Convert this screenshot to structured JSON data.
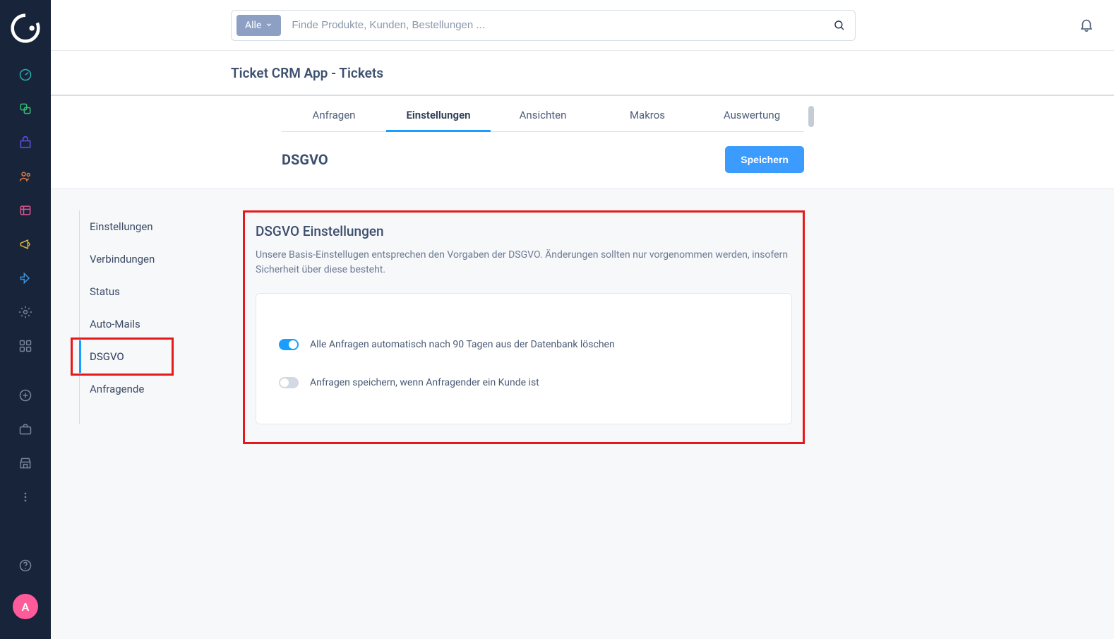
{
  "search": {
    "filter_label": "Alle",
    "placeholder": "Finde Produkte, Kunden, Bestellungen ..."
  },
  "page_title": "Ticket CRM App - Tickets",
  "tabs": [
    {
      "label": "Anfragen",
      "active": false
    },
    {
      "label": "Einstellungen",
      "active": true
    },
    {
      "label": "Ansichten",
      "active": false
    },
    {
      "label": "Makros",
      "active": false
    },
    {
      "label": "Auswertung",
      "active": false
    }
  ],
  "subheader": {
    "title": "DSGVO",
    "save_label": "Speichern"
  },
  "side_nav": [
    {
      "label": "Einstellungen",
      "active": false
    },
    {
      "label": "Verbindungen",
      "active": false
    },
    {
      "label": "Status",
      "active": false
    },
    {
      "label": "Auto-Mails",
      "active": false
    },
    {
      "label": "DSGVO",
      "active": true,
      "highlight": true
    },
    {
      "label": "Anfragende",
      "active": false
    }
  ],
  "card": {
    "title": "DSGVO Einstellungen",
    "description": "Unsere Basis-Einstellugen entsprechen den Vorgaben der DSGVO. Änderungen sollten nur vorgenommen werden, insofern Sicherheit über diese besteht.",
    "toggles": [
      {
        "label": "Alle Anfragen automatisch nach 90 Tagen aus der Datenbank löschen",
        "on": true
      },
      {
        "label": "Anfragen speichern, wenn Anfragender ein Kunde ist",
        "on": false
      }
    ]
  },
  "avatar_initial": "A",
  "rail_icons": [
    "dashboard-icon",
    "catalog-icon",
    "shop-icon",
    "customers-icon",
    "content-icon",
    "marketing-icon",
    "extensions-icon",
    "settings-icon",
    "apps-icon",
    "add-icon",
    "briefcase-icon",
    "store-icon",
    "more-icon"
  ],
  "bottom_help_icon": "help-icon",
  "annotation_color": "#e6191a"
}
